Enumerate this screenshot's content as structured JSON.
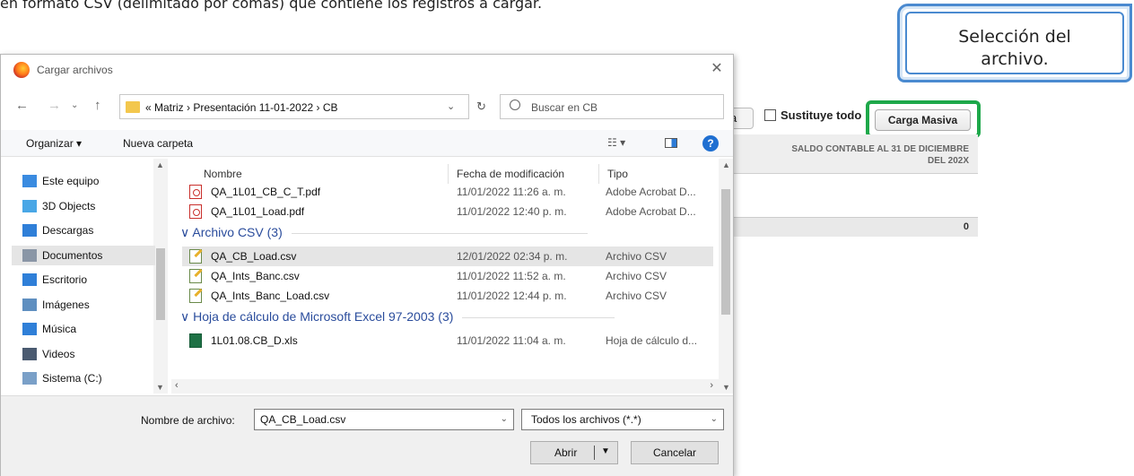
{
  "doc": {
    "text": "en formato CSV (delimitado por comas) que contiene los registros a cargar."
  },
  "callout": {
    "line1": "Selección del",
    "line2": "archivo."
  },
  "background": {
    "partial_button": "a",
    "replace_all_label": "Sustituye todo",
    "bulk_load_button": "Carga Masiva",
    "column_header_line1": "SALDO CONTABLE AL 31 DE DICIEMBRE",
    "column_header_line2": "DEL 202X",
    "total_value": "0",
    "accent_color": "#1ea84a"
  },
  "dialog": {
    "title": "Cargar archivos",
    "nav": {
      "breadcrumb": "«  Matriz  ›  Presentación 11-01-2022  ›  CB",
      "search_placeholder": "Buscar en CB"
    },
    "toolbar": {
      "organize": "Organizar ▾",
      "new_folder": "Nueva carpeta"
    },
    "sidebar": [
      {
        "label": "Este equipo",
        "icon": "computer-icon",
        "selected": false
      },
      {
        "label": "3D Objects",
        "icon": "cube-icon",
        "selected": false
      },
      {
        "label": "Descargas",
        "icon": "download-icon",
        "selected": false
      },
      {
        "label": "Documentos",
        "icon": "document-icon",
        "selected": true
      },
      {
        "label": "Escritorio",
        "icon": "desktop-icon",
        "selected": false
      },
      {
        "label": "Imágenes",
        "icon": "image-icon",
        "selected": false
      },
      {
        "label": "Música",
        "icon": "music-icon",
        "selected": false
      },
      {
        "label": "Videos",
        "icon": "video-icon",
        "selected": false
      },
      {
        "label": "Sistema (C:)",
        "icon": "drive-icon",
        "selected": false
      }
    ],
    "columns": {
      "name": "Nombre",
      "date": "Fecha de modificación",
      "type": "Tipo"
    },
    "groups": [
      {
        "label": "",
        "files": [
          {
            "name": "QA_1L01_CB_C_T.pdf",
            "date": "11/01/2022 11:26 a. m.",
            "type": "Adobe Acrobat D...",
            "icon": "pdf",
            "selected": false
          },
          {
            "name": "QA_1L01_Load.pdf",
            "date": "11/01/2022 12:40 p. m.",
            "type": "Adobe Acrobat D...",
            "icon": "pdf",
            "selected": false
          }
        ]
      },
      {
        "label": "Archivo CSV (3)",
        "files": [
          {
            "name": "QA_CB_Load.csv",
            "date": "12/01/2022 02:34 p. m.",
            "type": "Archivo CSV",
            "icon": "csv",
            "selected": true
          },
          {
            "name": "QA_Ints_Banc.csv",
            "date": "11/01/2022 11:52 a. m.",
            "type": "Archivo CSV",
            "icon": "csv",
            "selected": false
          },
          {
            "name": "QA_Ints_Banc_Load.csv",
            "date": "11/01/2022 12:44 p. m.",
            "type": "Archivo CSV",
            "icon": "csv",
            "selected": false
          }
        ]
      },
      {
        "label": "Hoja de cálculo de Microsoft Excel 97-2003 (3)",
        "files": [
          {
            "name": "1L01.08.CB_D.xls",
            "date": "11/01/2022 11:04 a. m.",
            "type": "Hoja de cálculo d...",
            "icon": "xls",
            "selected": false
          }
        ]
      }
    ],
    "footer": {
      "filename_label": "Nombre de archivo:",
      "filename_value": "QA_CB_Load.csv",
      "filter_value": "Todos los archivos (*.*)",
      "open_button": "Abrir",
      "cancel_button": "Cancelar"
    }
  }
}
